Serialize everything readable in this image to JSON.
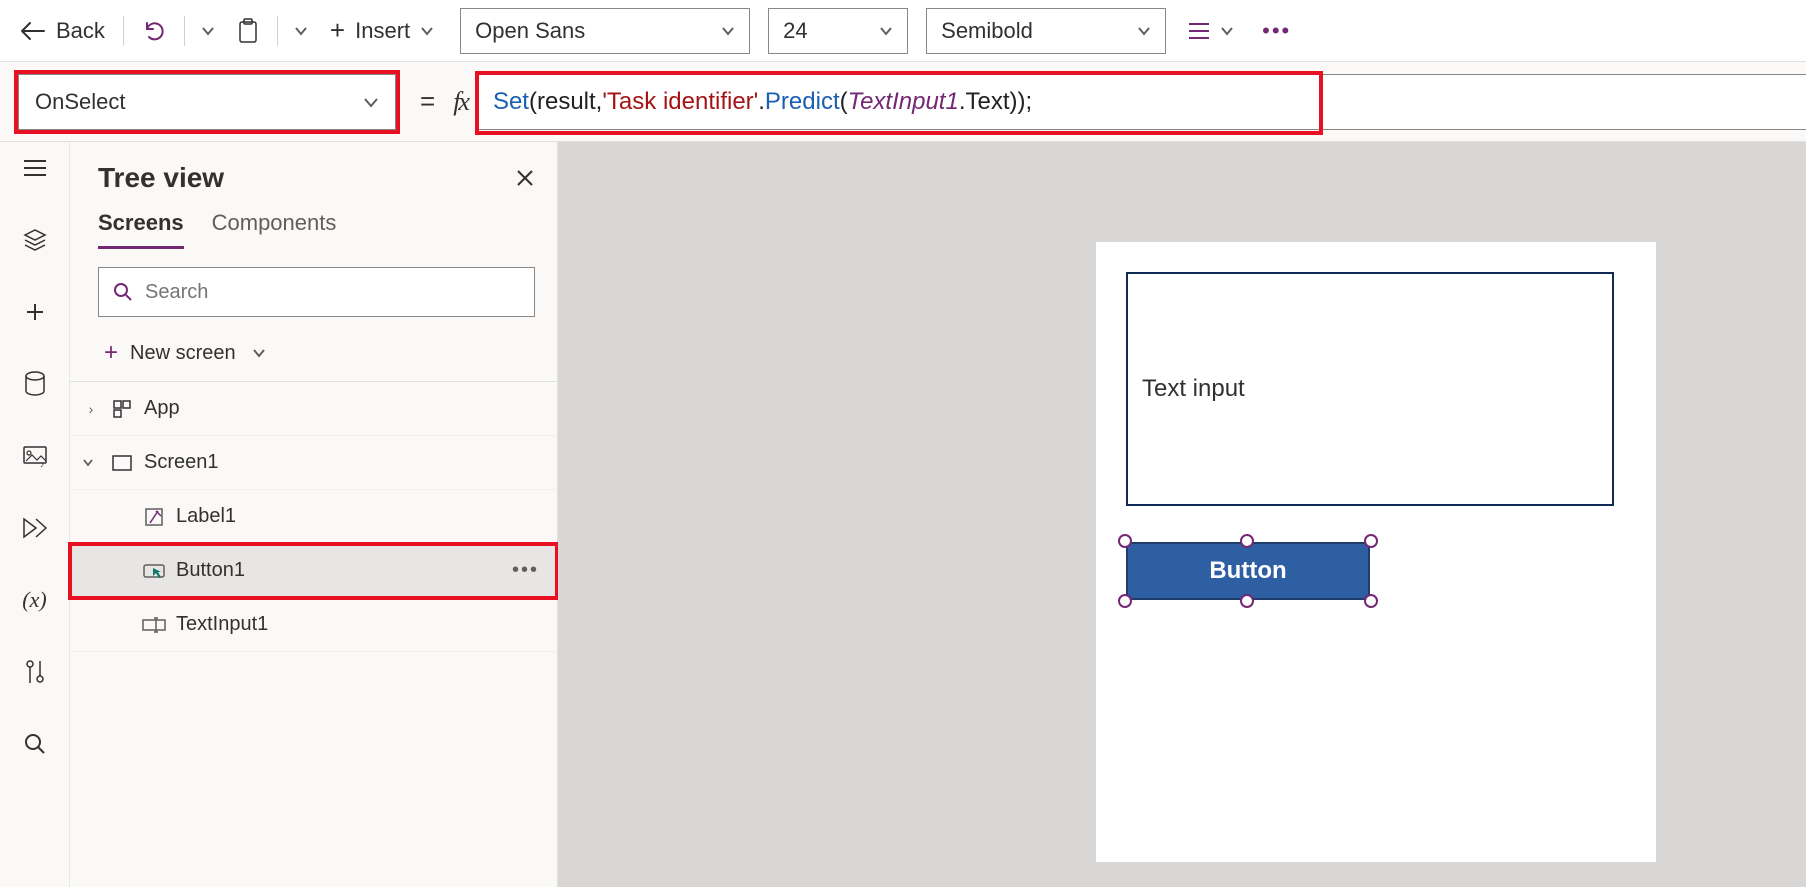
{
  "toolbar": {
    "back_label": "Back",
    "insert_label": "Insert",
    "font_family": "Open Sans",
    "font_size": "24",
    "font_weight": "Semibold"
  },
  "formula": {
    "property": "OnSelect",
    "segments": {
      "set": "Set",
      "openParen1": "(result, ",
      "taskQuote": "'Task identifier'",
      "dot1": ".",
      "predict": "Predict",
      "openParen2": "(",
      "textinput": "TextInput1",
      "dot2": ".Text));"
    }
  },
  "tree": {
    "title": "Tree view",
    "tabs": {
      "screens": "Screens",
      "components": "Components"
    },
    "search_placeholder": "Search",
    "new_screen": "New screen",
    "nodes": {
      "app": "App",
      "screen1": "Screen1",
      "label1": "Label1",
      "button1": "Button1",
      "textinput1": "TextInput1"
    }
  },
  "canvas": {
    "text_input_value": "Text input",
    "button_label": "Button"
  }
}
